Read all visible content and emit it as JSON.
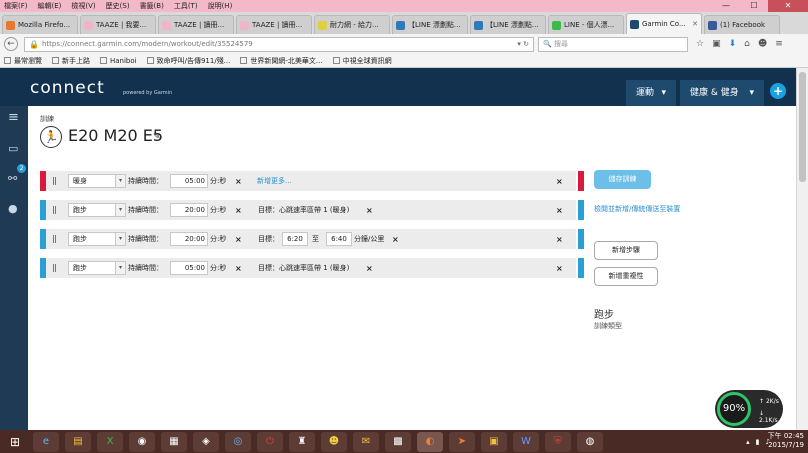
{
  "menu": [
    "檔案(F)",
    "編輯(E)",
    "檢視(V)",
    "歷史(S)",
    "書籤(B)",
    "工具(T)",
    "說明(H)"
  ],
  "tabs": [
    {
      "label": "Mozilla Firefo...",
      "color": "#e8782c"
    },
    {
      "label": "TAAZE | 我要...",
      "color": "#f0b6c8"
    },
    {
      "label": "TAAZE | 讀冊...",
      "color": "#f0b6c8"
    },
    {
      "label": "TAAZE | 讀冊...",
      "color": "#f0b6c8"
    },
    {
      "label": "耐力網 - 給力...",
      "color": "#e0d040"
    },
    {
      "label": "【LINE 漂劃點...",
      "color": "#2f7ab8"
    },
    {
      "label": "【LINE 漂劃點...",
      "color": "#2f7ab8"
    },
    {
      "label": "LINE - 個人漂...",
      "color": "#3cba4a"
    },
    {
      "label": "Garmin Co...",
      "color": "#1e4a6d"
    },
    {
      "label": "(1) Facebook",
      "color": "#3b5998"
    }
  ],
  "address": {
    "url": "https://connect.garmin.com/modern/workout/edit/35524579",
    "search_placeholder": "搜尋"
  },
  "bookmarks": [
    "最常瀏覽",
    "新手上路",
    "Haniboi",
    "致命呼叫/告傳911/殘...",
    "世界新聞網-北美華文...",
    "中視全球資訊網"
  ],
  "header": {
    "logo": "connect",
    "logo_sub": "powered by Garmin",
    "nav1": "運動",
    "nav2": "健康 & 健身",
    "plus": "+"
  },
  "sidebar": {
    "badge": "2"
  },
  "workout": {
    "crumb": "訓練",
    "title": "E20 M20 E5",
    "steps": [
      {
        "type": "暖身",
        "dur_label": "持續時間：",
        "dur": "05:00",
        "unit": "分:秒",
        "link": "新增更多..."
      },
      {
        "type": "跑步",
        "dur_label": "持續時間：",
        "dur": "20:00",
        "unit": "分:秒",
        "target": "目標：心跳速率區帶 1 (暖身)"
      },
      {
        "type": "跑步",
        "dur_label": "持續時間：",
        "dur": "20:00",
        "unit": "分:秒",
        "target_label": "目標：",
        "from": "6:20",
        "to_word": "至",
        "to": "6:40",
        "pace_unit": "分鐘/公里"
      },
      {
        "type": "跑步",
        "dur_label": "持續時間：",
        "dur": "05:00",
        "unit": "分:秒",
        "target": "目標：心跳速率區帶 1 (暖身)"
      }
    ]
  },
  "actions": {
    "save": "儲存訓練",
    "check_link": "檢閱並新增/傳統傳送至裝置",
    "add_step": "新增步驟",
    "add_repeat": "新增重複性"
  },
  "sport": {
    "title": "跑步",
    "subtitle": "訓練類型"
  },
  "gauge": {
    "percent": "90%",
    "up": "2K/s",
    "down": "2.1K/s"
  },
  "clock": {
    "time": "下午 02:45",
    "date": "2015/7/19"
  }
}
